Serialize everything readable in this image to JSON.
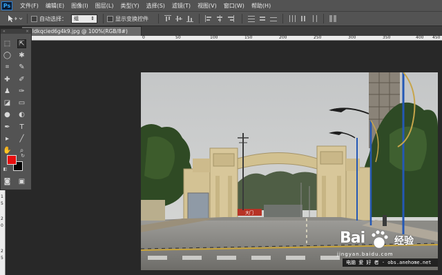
{
  "app": {
    "logo": "Ps"
  },
  "menu": [
    "文件(F)",
    "编辑(E)",
    "图像(I)",
    "图层(L)",
    "类型(Y)",
    "选择(S)",
    "滤镜(T)",
    "视图(V)",
    "窗口(W)",
    "帮助(H)"
  ],
  "options": {
    "auto_select_label": "自动选择：",
    "auto_select_value": "组",
    "show_transform_label": "显示变换控件"
  },
  "document": {
    "tab_title": "ldkqcied6g4k9.jpg @ 100%(RGB/8#)",
    "close_glyph": "×"
  },
  "ruler": {
    "h_labels": [
      "0",
      "0",
      "50",
      "100",
      "150",
      "200",
      "250",
      "300",
      "350",
      "400",
      "450"
    ],
    "v_labels": [
      "1",
      "5",
      "2",
      "0",
      "2",
      "5"
    ]
  },
  "colors": {
    "foreground": "#e60f0f",
    "background": "#050505",
    "ui_bg": "#535353",
    "canvas_bg": "#282828"
  },
  "photo": {
    "sign_text": "大门"
  },
  "watermark": {
    "brand": "Bai",
    "brand_cn": "经验",
    "url": "jingyan.baidu.com",
    "bar_text": "电脑 爱 好 者 · obs.anehome.net"
  },
  "tools": [
    "move-tool",
    "marquee-tool",
    "lasso-tool",
    "magic-wand-tool",
    "crop-tool",
    "eyedropper-tool",
    "healing-brush-tool",
    "brush-tool",
    "clone-stamp-tool",
    "history-brush-tool",
    "eraser-tool",
    "gradient-tool",
    "blur-tool",
    "dodge-tool",
    "pen-tool",
    "type-tool",
    "path-selection-tool",
    "line-tool",
    "hand-tool",
    "zoom-tool"
  ]
}
